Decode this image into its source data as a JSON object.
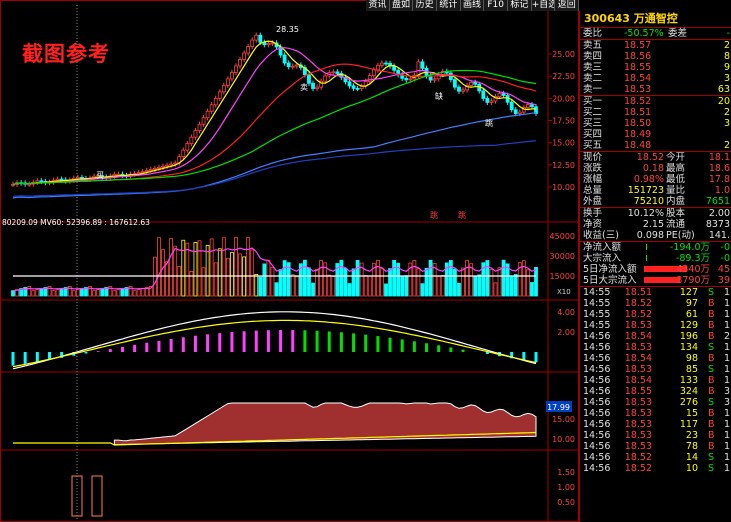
{
  "toolbar": {
    "items": [
      "资讯",
      "盘如",
      "历史",
      "统计",
      "画线",
      "F10",
      "标记",
      "+自选",
      "返回"
    ]
  },
  "watermark": "截图参考",
  "stock": {
    "code_name": "300643 万通智控"
  },
  "chart_labels": {
    "peak": "28.35",
    "main_y_ticks": [
      "25.00",
      "22.50",
      "20.00",
      "17.50",
      "15.00",
      "12.50",
      "10.00"
    ],
    "markers": [
      "买",
      "卖",
      "缺",
      "跳",
      "跳",
      "跳"
    ],
    "vol_info": "80209.09 MV60: 52396.89 : 167612.63",
    "vol_y_ticks": [
      "45000",
      "30000",
      "15000"
    ],
    "vol_unit": "X10",
    "ind2_y_ticks": [
      "4.00",
      "2.00"
    ],
    "ind3_y_ticks": [
      "17.99",
      "15.00",
      "10.00"
    ],
    "ind4_y_ticks": [
      "1.50",
      "1.00",
      "0.50"
    ]
  },
  "quote": {
    "weibi": {
      "label": "委比",
      "value": "-50.57%",
      "label2": "委差",
      "value2": "-"
    },
    "asks": [
      {
        "label": "卖五",
        "price": "18.57",
        "vol": "2"
      },
      {
        "label": "卖四",
        "price": "18.56",
        "vol": "8"
      },
      {
        "label": "卖三",
        "price": "18.55",
        "vol": "9"
      },
      {
        "label": "卖二",
        "price": "18.54",
        "vol": "3"
      },
      {
        "label": "卖一",
        "price": "18.53",
        "vol": "63"
      }
    ],
    "bids": [
      {
        "label": "买一",
        "price": "18.52",
        "vol": "20"
      },
      {
        "label": "买二",
        "price": "18.51",
        "vol": "2"
      },
      {
        "label": "买三",
        "price": "18.50",
        "vol": "3"
      },
      {
        "label": "买四",
        "price": "18.49",
        "vol": ""
      },
      {
        "label": "买五",
        "price": "18.48",
        "vol": "2"
      }
    ],
    "stats": [
      {
        "l1": "现价",
        "v1": "18.52",
        "l2": "今开",
        "v2": "18.1"
      },
      {
        "l1": "涨跌",
        "v1": "0.18",
        "l2": "最高",
        "v2": "18.6"
      },
      {
        "l1": "涨幅",
        "v1": "0.98%",
        "l2": "最低",
        "v2": "17.8"
      },
      {
        "l1": "总量",
        "v1": "151723",
        "l2": "量比",
        "v2": "1.0"
      },
      {
        "l1": "外盘",
        "v1": "75210",
        "l2": "内盘",
        "v2": "7651"
      }
    ],
    "stats2": [
      {
        "l1": "换手",
        "v1": "10.12%",
        "l2": "股本",
        "v2": "2.00"
      },
      {
        "l1": "净资",
        "v1": "2.15",
        "l2": "流通",
        "v2": "8373"
      },
      {
        "l1": "收益(三)",
        "v1": "0.098",
        "l2": "PE(动)",
        "v2": "141."
      }
    ],
    "flows": [
      {
        "label": "净流入额",
        "value": "-194.0万",
        "extra": "-0"
      },
      {
        "label": "大宗流入",
        "value": "-89.3万",
        "extra": "-0"
      },
      {
        "label": "5日净流入额",
        "value": "4340万",
        "extra": "45"
      },
      {
        "label": "5日大宗流入",
        "value": "3790万",
        "extra": "39"
      }
    ]
  },
  "ticks": [
    {
      "time": "14:55",
      "price": "18.51",
      "vol": "127",
      "side": "S",
      "n": "1"
    },
    {
      "time": "14:55",
      "price": "18.52",
      "vol": "97",
      "side": "B",
      "n": "1"
    },
    {
      "time": "14:55",
      "price": "18.52",
      "vol": "61",
      "side": "B",
      "n": "1"
    },
    {
      "time": "14:55",
      "price": "18.53",
      "vol": "129",
      "side": "B",
      "n": "1"
    },
    {
      "time": "14:56",
      "price": "18.54",
      "vol": "196",
      "side": "B",
      "n": "2"
    },
    {
      "time": "14:56",
      "price": "18.53",
      "vol": "134",
      "side": "S",
      "n": "1"
    },
    {
      "time": "14:56",
      "price": "18.54",
      "vol": "98",
      "side": "B",
      "n": "1"
    },
    {
      "time": "14:56",
      "price": "18.53",
      "vol": "85",
      "side": "S",
      "n": "1"
    },
    {
      "time": "14:56",
      "price": "18.54",
      "vol": "133",
      "side": "B",
      "n": "1"
    },
    {
      "time": "14:56",
      "price": "18.55",
      "vol": "324",
      "side": "B",
      "n": "3"
    },
    {
      "time": "14:56",
      "price": "18.53",
      "vol": "276",
      "side": "S",
      "n": "3"
    },
    {
      "time": "14:56",
      "price": "18.53",
      "vol": "15",
      "side": "B",
      "n": "1"
    },
    {
      "time": "14:56",
      "price": "18.53",
      "vol": "117",
      "side": "B",
      "n": "1"
    },
    {
      "time": "14:56",
      "price": "18.53",
      "vol": "23",
      "side": "B",
      "n": "1"
    },
    {
      "time": "14:56",
      "price": "18.53",
      "vol": "78",
      "side": "B",
      "n": "1"
    },
    {
      "time": "14:56",
      "price": "18.52",
      "vol": "14",
      "side": "S",
      "n": "1"
    },
    {
      "time": "14:56",
      "price": "18.52",
      "vol": "10",
      "side": "S",
      "n": "1"
    }
  ],
  "colors": {
    "up": "#ff4040",
    "down": "#00ffff",
    "yellow": "#ffff00",
    "magenta": "#ff40ff",
    "red_line": "#ff2020",
    "green_line": "#00e000",
    "blue_line": "#2080ff",
    "frame": "#a00000"
  }
}
